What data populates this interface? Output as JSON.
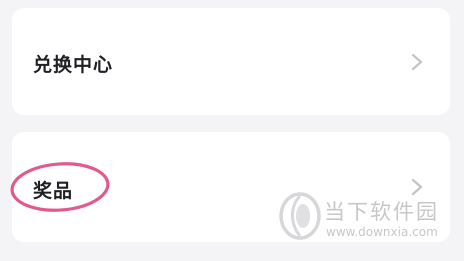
{
  "menu": {
    "items": [
      {
        "label": "兑换中心"
      },
      {
        "label": "奖品"
      }
    ]
  },
  "highlight": {
    "color": "#e05a8e",
    "target": "奖品"
  },
  "watermark": {
    "name": "当下软件园",
    "url": "www.downxia.com"
  },
  "colors": {
    "background": "#f4f4f6",
    "card": "#ffffff",
    "text": "#1f1f24",
    "chevron": "#c4c4c8"
  },
  "icons": {
    "row_arrow": "chevron-right-icon",
    "watermark_logo": "downxia-logo-icon"
  }
}
